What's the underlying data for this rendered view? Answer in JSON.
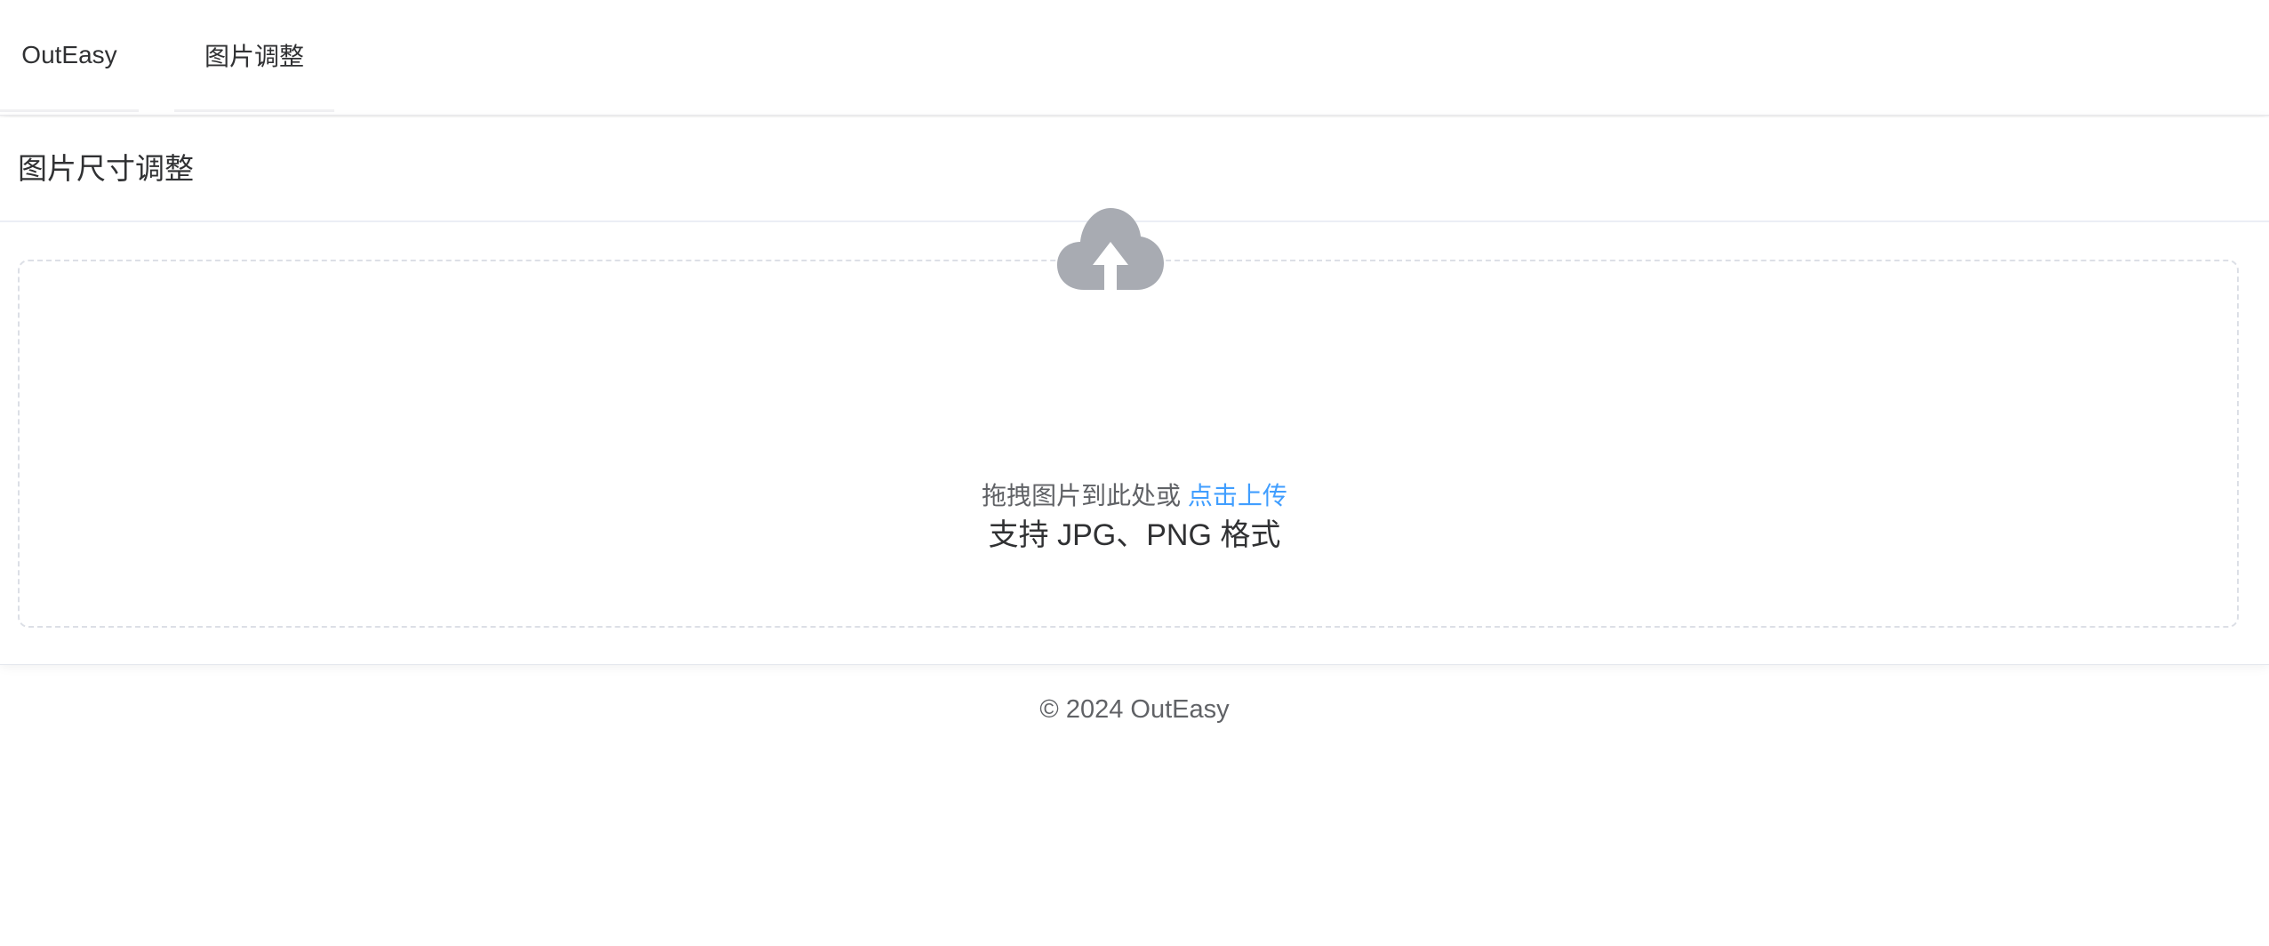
{
  "nav": {
    "brand": "OutEasy",
    "items": [
      {
        "label": "图片调整"
      }
    ]
  },
  "card": {
    "title": "图片尺寸调整"
  },
  "upload": {
    "icon": "cloud-upload-icon",
    "prompt": "拖拽图片到此处或",
    "link_label": "点击上传",
    "tip": "支持 JPG、PNG 格式"
  },
  "footer": {
    "copyright": "© 2024 OutEasy"
  },
  "colors": {
    "accent": "#409eff",
    "icon": "#a8abb2",
    "text": "#303133",
    "muted": "#606266",
    "border": "#dcdfe6"
  }
}
